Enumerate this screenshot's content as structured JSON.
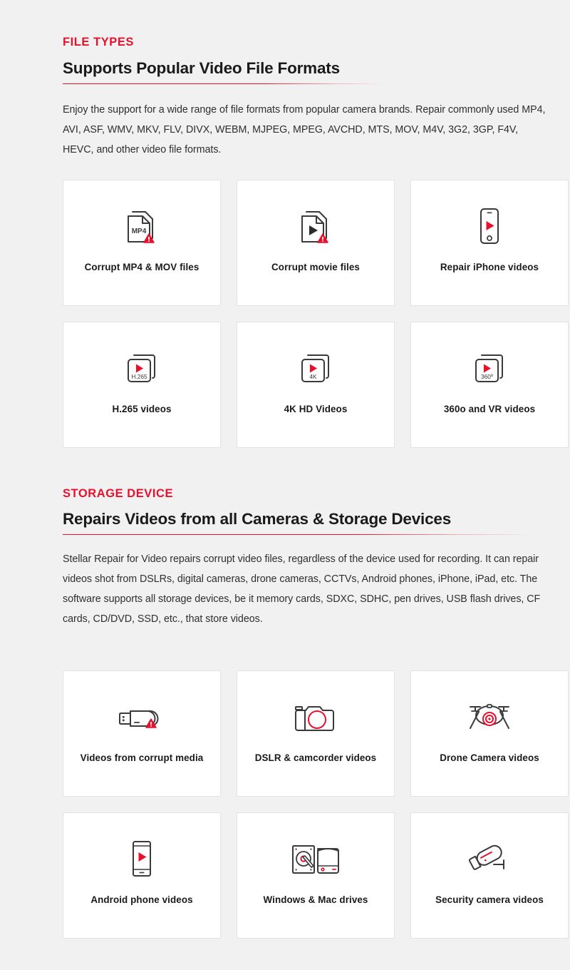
{
  "theme": {
    "accent_red": "#E8112D",
    "page_background": "#F1F1F1",
    "card_background": "#FFFFFF",
    "card_border": "#E3E3E3",
    "text_dark": "#1A1A1A"
  },
  "sections": [
    {
      "eyebrow": "FILE TYPES",
      "title": "Supports Popular Video File Formats",
      "body": "Enjoy the support for a wide range of file formats from popular camera brands. Repair commonly used MP4, AVI, ASF, WMV, MKV, FLV, DIVX, WEBM, MJPEG, MPEG, AVCHD, MTS, MOV, M4V, 3G2, 3GP, F4V, HEVC, and other video file formats.",
      "cards": [
        {
          "label": "Corrupt MP4 & MOV files",
          "icon": "file-mp4-warning-icon",
          "icon_text": "MP4"
        },
        {
          "label": "Corrupt movie files",
          "icon": "file-play-warning-icon",
          "icon_text": ""
        },
        {
          "label": "Repair iPhone videos",
          "icon": "iphone-play-icon",
          "icon_text": ""
        },
        {
          "label": "H.265 videos",
          "icon": "video-stack-play-icon",
          "icon_text": "H.265"
        },
        {
          "label": "4K HD Videos",
          "icon": "video-stack-play-icon",
          "icon_text": "4K"
        },
        {
          "label": "360o and VR videos",
          "icon": "video-stack-play-icon",
          "icon_text": "360º"
        }
      ]
    },
    {
      "eyebrow": "STORAGE DEVICE",
      "title": "Repairs Videos from all Cameras & Storage Devices",
      "body": "Stellar Repair for Video repairs corrupt video files, regardless of the device used for recording. It can repair videos shot from DSLRs, digital cameras, drone cameras, CCTVs, Android phones, iPhone, iPad, etc. The software supports all storage devices, be it memory cards, SDXC, SDHC, pen drives, USB flash drives, CF cards, CD/DVD, SSD, etc., that store videos.",
      "cards": [
        {
          "label": "Videos from corrupt media",
          "icon": "usb-drive-warning-icon",
          "icon_text": ""
        },
        {
          "label": "DSLR & camcorder videos",
          "icon": "dslr-camera-icon",
          "icon_text": ""
        },
        {
          "label": "Drone Camera videos",
          "icon": "drone-camera-icon",
          "icon_text": ""
        },
        {
          "label": "Android phone videos",
          "icon": "android-phone-play-icon",
          "icon_text": ""
        },
        {
          "label": "Windows & Mac drives",
          "icon": "hard-drives-icon",
          "icon_text": ""
        },
        {
          "label": "Security camera videos",
          "icon": "security-camera-icon",
          "icon_text": ""
        }
      ]
    }
  ]
}
